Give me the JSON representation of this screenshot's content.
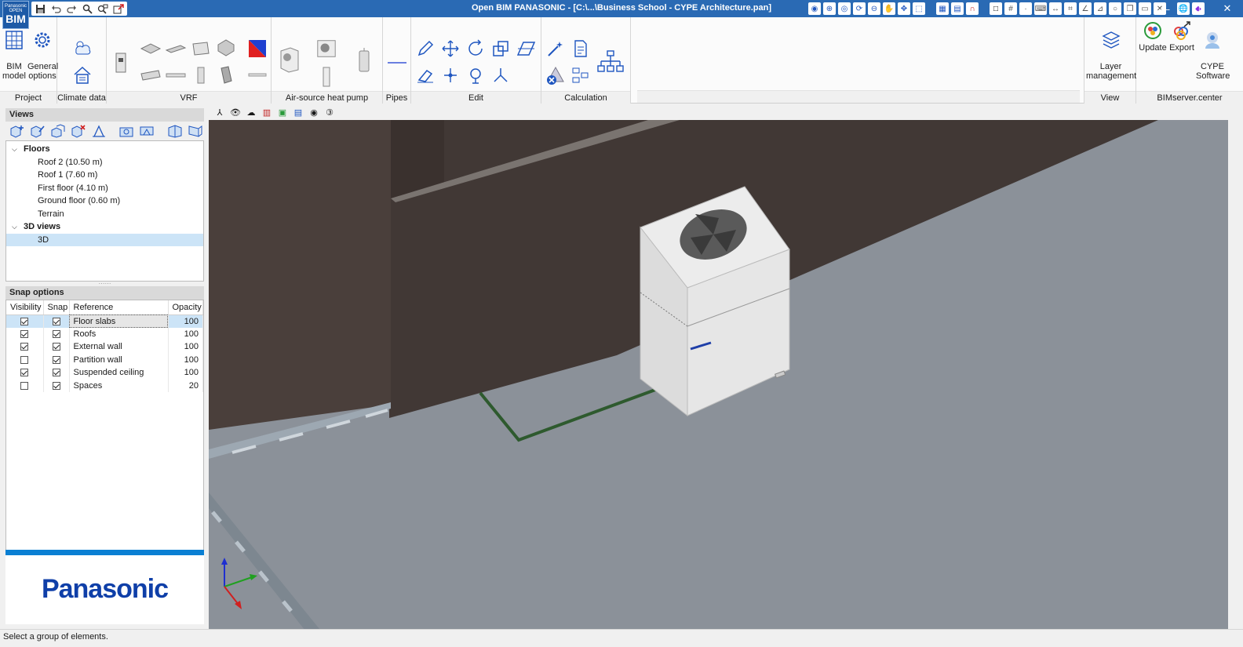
{
  "titlebar": {
    "title": "Open BIM PANASONIC - [C:\\...\\Business School - CYPE Architecture.pan]",
    "logo_top": "Panasonic",
    "logo_mid": "OPEN",
    "logo_main": "BIM",
    "accent_color": "#2a6ab4"
  },
  "quick_access": [
    "save-icon",
    "undo-icon",
    "redo-icon",
    "search-icon",
    "find-replace-icon",
    "export-icon"
  ],
  "ribbon": {
    "project": {
      "label": "Project",
      "bim_model": "BIM\nmodel",
      "general_options": "General\noptions"
    },
    "climate": {
      "label": "Climate data"
    },
    "vrf": {
      "label": "VRF"
    },
    "ashp": {
      "label": "Air-source heat pump"
    },
    "pipes": {
      "label": "Pipes"
    },
    "edit": {
      "label": "Edit"
    },
    "calculation": {
      "label": "Calculation"
    },
    "view": {
      "label": "View",
      "layer_management": "Layer\nmanagement"
    },
    "bimserver": {
      "label": "BIMserver.center",
      "update": "Update",
      "export": "Export",
      "cype": "CYPE\nSoftware"
    }
  },
  "views_panel": {
    "title": "Views",
    "floors_label": "Floors",
    "floors": [
      "Roof 2 (10.50 m)",
      "Roof 1 (7.60 m)",
      "First floor (4.10 m)",
      "Ground floor (0.60 m)",
      "Terrain"
    ],
    "views3d_label": "3D views",
    "views3d": [
      "3D"
    ]
  },
  "snap_panel": {
    "title": "Snap options",
    "headers": [
      "Visibility",
      "Snap",
      "Reference",
      "Opacity"
    ],
    "rows": [
      {
        "visible": true,
        "snap": true,
        "reference": "Floor slabs",
        "opacity": "100"
      },
      {
        "visible": true,
        "snap": true,
        "reference": "Roofs",
        "opacity": "100"
      },
      {
        "visible": true,
        "snap": true,
        "reference": "External wall",
        "opacity": "100"
      },
      {
        "visible": false,
        "snap": true,
        "reference": "Partition wall",
        "opacity": "100"
      },
      {
        "visible": true,
        "snap": true,
        "reference": "Suspended ceiling",
        "opacity": "100"
      },
      {
        "visible": false,
        "snap": true,
        "reference": "Spaces",
        "opacity": "20"
      }
    ]
  },
  "brand": {
    "name": "Panasonic",
    "color": "#0f3fa8",
    "bar_color": "#0a7fd3"
  },
  "status": {
    "text": "Select a group of elements."
  }
}
